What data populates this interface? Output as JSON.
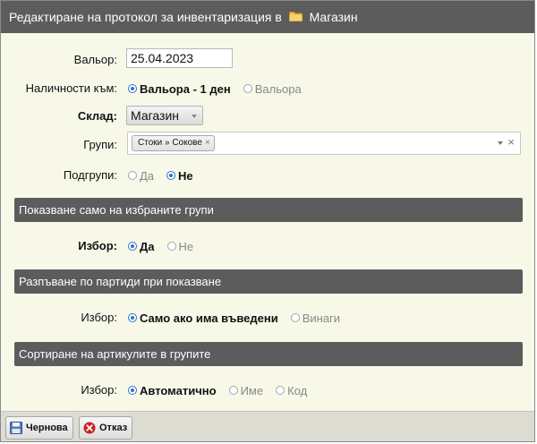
{
  "dialog": {
    "title": "Редактиране на протокол за инвентаризация в",
    "store": "Магазин"
  },
  "form": {
    "valior_label": "Вальор:",
    "valior_value": "25.04.2023",
    "stock_label": "Наличности към:",
    "stock_options": [
      "Вальора - 1 ден",
      "Вальора"
    ],
    "warehouse_label": "Склад:",
    "warehouse_value": "Магазин",
    "groups_label": "Групи:",
    "groups_tag": "Стоки » Сокове",
    "subgroups_label": "Подгрупи:",
    "subgroups_options": [
      "Да",
      "Не"
    ]
  },
  "sections": [
    {
      "title": "Показване само на избраните групи",
      "label": "Избор:",
      "options": [
        "Да",
        "Не"
      ]
    },
    {
      "title": "Разпъване по партиди при показване",
      "label": "Избор:",
      "options": [
        "Само ако има въведени",
        "Винаги"
      ]
    },
    {
      "title": "Сортиране на артикулите в групите",
      "label": "Избор:",
      "options": [
        "Автоматично",
        "Име",
        "Код"
      ]
    }
  ],
  "footer": {
    "draft_label": "Чернова",
    "cancel_label": "Отказ"
  },
  "colors": {
    "header_bg": "#5c5c5c",
    "body_bg": "#f8f8e9",
    "radio_accent": "#2a73c8",
    "cancel_icon": "#cc2222"
  },
  "selected": {
    "stock": 0,
    "subgroups": 1,
    "section0": 0,
    "section1": 0,
    "section2": 0
  }
}
